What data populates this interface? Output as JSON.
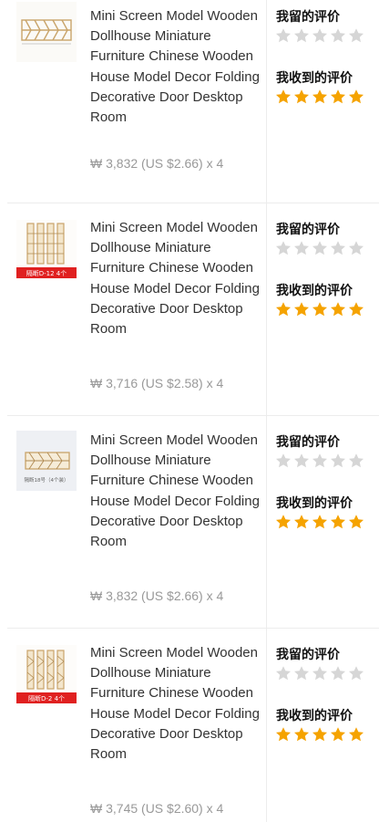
{
  "colors": {
    "star_filled": "#f5a300",
    "star_empty": "#d6d6d6",
    "title_text": "#333333",
    "price_text": "#999999",
    "tag_red": "#e02020"
  },
  "items": [
    {
      "thumbnail_icon": "wooden-screen-panel-image",
      "thumbnail_caption": "",
      "title": "Mini Screen Model Wooden Dollhouse Miniature Furniture Chinese Wooden House Model Decor Folding Decorative Door Desktop Room",
      "price": "₩ 3,832 (US $2.66) x 4",
      "my_review_label": "我留的评价",
      "my_review_stars": 0,
      "received_review_label": "我收到的评价",
      "received_review_stars": 5
    },
    {
      "thumbnail_icon": "wooden-screen-panels-image",
      "thumbnail_caption": "隔断D-12 4个",
      "title": "Mini Screen Model Wooden Dollhouse Miniature Furniture Chinese Wooden House Model Decor Folding Decorative Door Desktop Room",
      "price": "₩ 3,716 (US $2.58) x 4",
      "my_review_label": "我留的评价",
      "my_review_stars": 0,
      "received_review_label": "我收到的评价",
      "received_review_stars": 5
    },
    {
      "thumbnail_icon": "wooden-screen-panel-image",
      "thumbnail_caption": "隔断18号（4个装）",
      "title": "Mini Screen Model Wooden Dollhouse Miniature Furniture Chinese Wooden House Model Decor Folding Decorative Door Desktop Room",
      "price": "₩ 3,832 (US $2.66) x 4",
      "my_review_label": "我留的评价",
      "my_review_stars": 0,
      "received_review_label": "我收到的评价",
      "received_review_stars": 5
    },
    {
      "thumbnail_icon": "wooden-screen-panels-image",
      "thumbnail_caption": "隔断D-2 4个",
      "title": "Mini Screen Model Wooden Dollhouse Miniature Furniture Chinese Wooden House Model Decor Folding Decorative Door Desktop Room",
      "price": "₩ 3,745 (US $2.60) x 4",
      "my_review_label": "我留的评价",
      "my_review_stars": 0,
      "received_review_label": "我收到的评价",
      "received_review_stars": 5
    }
  ]
}
